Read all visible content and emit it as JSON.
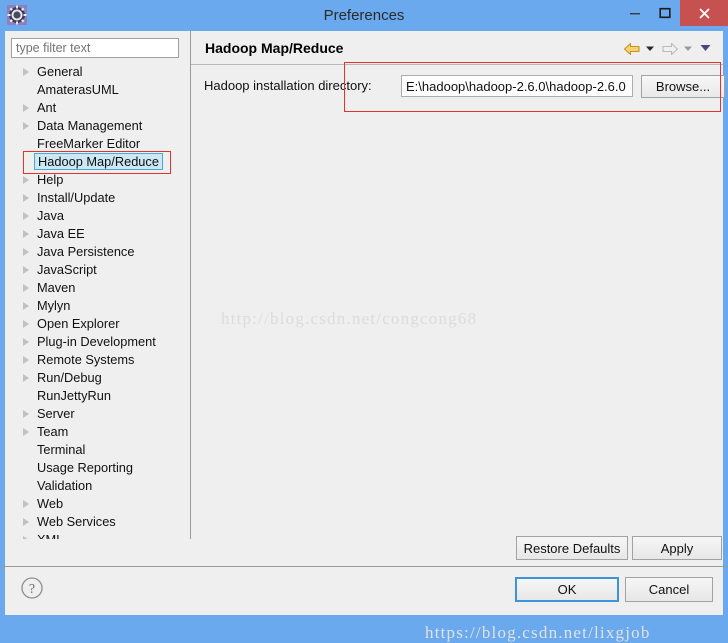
{
  "window": {
    "title": "Preferences",
    "app_icon": "gear-icon",
    "controls": {
      "minimize": "–",
      "maximize": "▢",
      "close": "✕",
      "close_color": "#c75050"
    },
    "titlebar_color": "#6aa9ee"
  },
  "sidebar": {
    "filter": {
      "placeholder": "type filter text",
      "value": ""
    },
    "items": [
      {
        "label": "General",
        "expandable": true,
        "selected": false
      },
      {
        "label": "AmaterasUML",
        "expandable": false,
        "selected": false
      },
      {
        "label": "Ant",
        "expandable": true,
        "selected": false
      },
      {
        "label": "Data Management",
        "expandable": true,
        "selected": false
      },
      {
        "label": "FreeMarker Editor",
        "expandable": false,
        "selected": false
      },
      {
        "label": "Hadoop Map/Reduce",
        "expandable": false,
        "selected": true
      },
      {
        "label": "Help",
        "expandable": true,
        "selected": false
      },
      {
        "label": "Install/Update",
        "expandable": true,
        "selected": false
      },
      {
        "label": "Java",
        "expandable": true,
        "selected": false
      },
      {
        "label": "Java EE",
        "expandable": true,
        "selected": false
      },
      {
        "label": "Java Persistence",
        "expandable": true,
        "selected": false
      },
      {
        "label": "JavaScript",
        "expandable": true,
        "selected": false
      },
      {
        "label": "Maven",
        "expandable": true,
        "selected": false
      },
      {
        "label": "Mylyn",
        "expandable": true,
        "selected": false
      },
      {
        "label": "Open Explorer",
        "expandable": true,
        "selected": false
      },
      {
        "label": "Plug-in Development",
        "expandable": true,
        "selected": false
      },
      {
        "label": "Remote Systems",
        "expandable": true,
        "selected": false
      },
      {
        "label": "Run/Debug",
        "expandable": true,
        "selected": false
      },
      {
        "label": "RunJettyRun",
        "expandable": false,
        "selected": false
      },
      {
        "label": "Server",
        "expandable": true,
        "selected": false
      },
      {
        "label": "Team",
        "expandable": true,
        "selected": false
      },
      {
        "label": "Terminal",
        "expandable": false,
        "selected": false
      },
      {
        "label": "Usage Reporting",
        "expandable": false,
        "selected": false
      },
      {
        "label": "Validation",
        "expandable": false,
        "selected": false
      },
      {
        "label": "Web",
        "expandable": true,
        "selected": false
      },
      {
        "label": "Web Services",
        "expandable": true,
        "selected": false
      },
      {
        "label": "XML",
        "expandable": true,
        "selected": false
      }
    ]
  },
  "page": {
    "title": "Hadoop Map/Reduce",
    "nav": {
      "back_icon": "back-arrow-icon",
      "back_color": "#e8b33c",
      "back_menu_icon": "chevron-down-icon",
      "forward_icon": "forward-arrow-icon",
      "forward_color": "#cfcfcf",
      "forward_menu_icon": "chevron-down-icon",
      "menu_icon": "chevron-down-icon",
      "menu_color": "#5a4fa0"
    },
    "field": {
      "label": "Hadoop installation directory:",
      "value": "E:\\hadoop\\hadoop-2.6.0\\hadoop-2.6.0",
      "browse_label": "Browse..."
    },
    "annotation_color": "#e8312a"
  },
  "actions": {
    "restore_defaults": "Restore Defaults",
    "apply": "Apply"
  },
  "footer": {
    "help_icon": "question-mark-icon",
    "ok": "OK",
    "cancel": "Cancel"
  },
  "watermarks": {
    "main": "http://blog.csdn.net/congcong68",
    "bottom": "https://blog.csdn.net/lixgjob"
  }
}
